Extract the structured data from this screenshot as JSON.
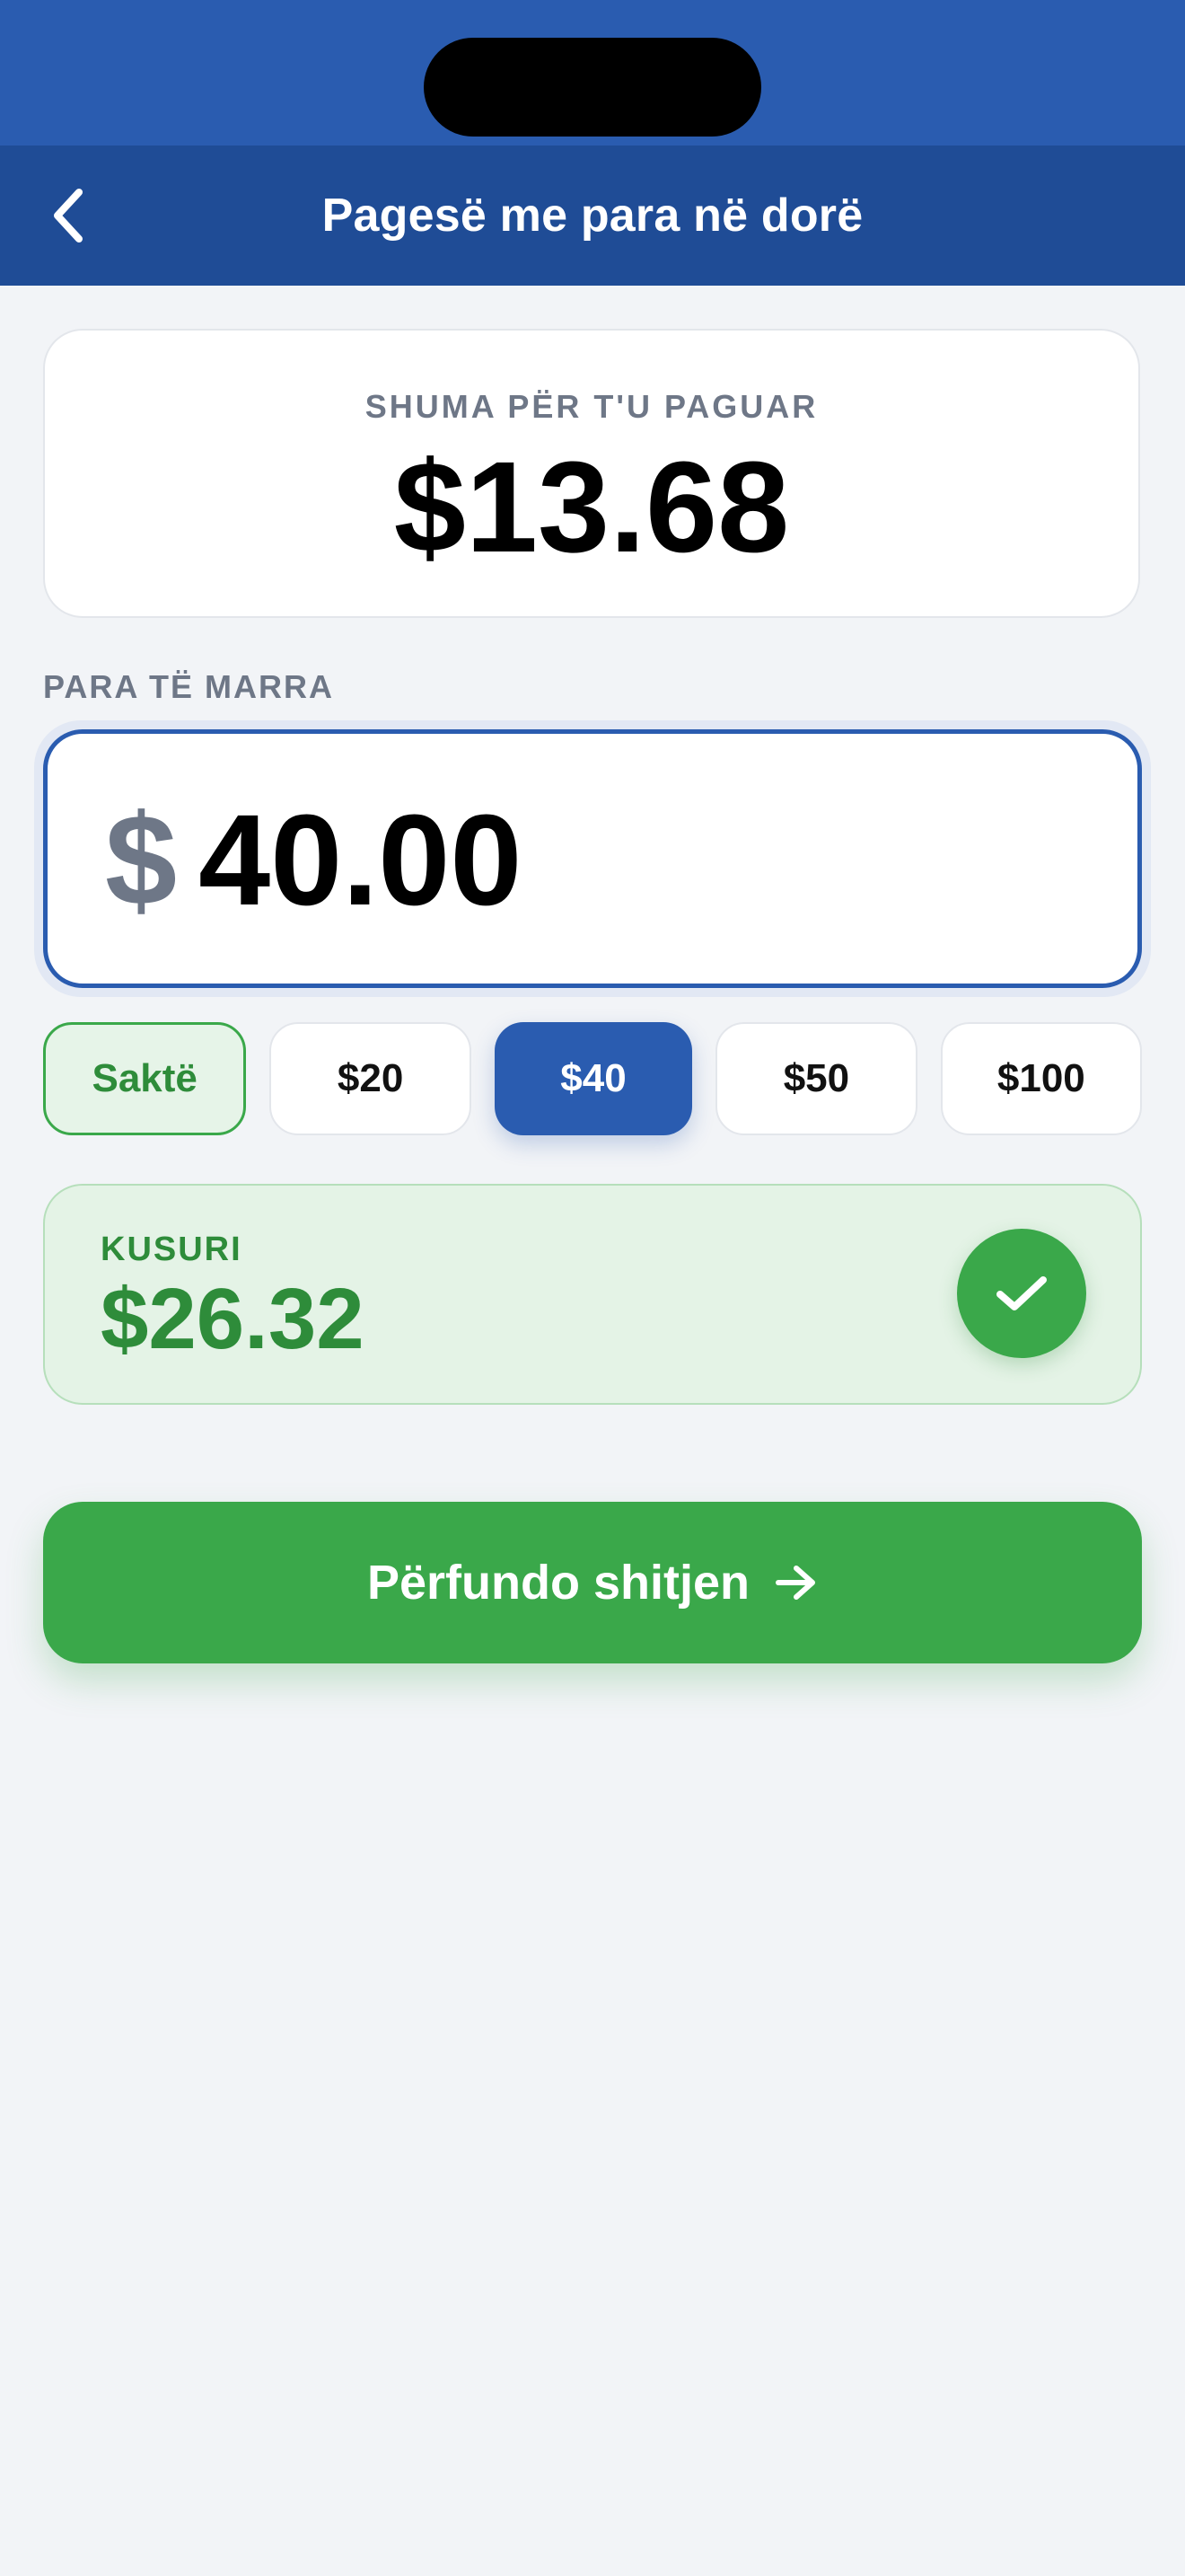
{
  "header": {
    "title": "Pagesë me para në dorë",
    "back_icon": "chevron-left-icon"
  },
  "amount_due": {
    "label": "SHUMA PËR T'U PAGUAR",
    "value": "$13.68"
  },
  "cash_received": {
    "label": "PARA TË MARRA",
    "currency_symbol": "$",
    "value": "40.00"
  },
  "quick_amounts": [
    {
      "label": "Saktë",
      "state": "exact"
    },
    {
      "label": "$20",
      "state": "default"
    },
    {
      "label": "$40",
      "state": "selected"
    },
    {
      "label": "$50",
      "state": "default"
    },
    {
      "label": "$100",
      "state": "default"
    }
  ],
  "change": {
    "label": "KUSURI",
    "value": "$26.32",
    "icon": "checkmark-icon"
  },
  "finish_button": {
    "label": "Përfundo shitjen",
    "icon": "arrow-right-icon"
  },
  "colors": {
    "primary_blue": "#2a5cb0",
    "nav_blue": "#1f4c96",
    "success_green": "#3aa84a",
    "success_text": "#2e8c3a",
    "muted_text": "#6e7787",
    "background": "#f2f4f7"
  }
}
